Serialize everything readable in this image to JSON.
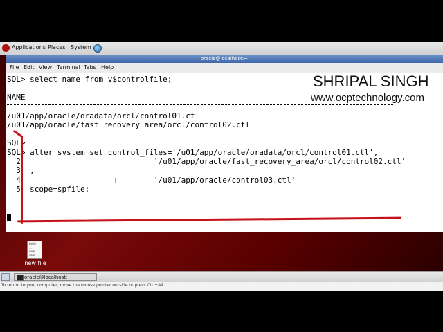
{
  "top_panel": {
    "applications": "Applications",
    "places": "Places",
    "system": "System"
  },
  "terminal": {
    "title": "oracle@localhost:~",
    "menu": [
      "File",
      "Edit",
      "View",
      "Terminal",
      "Tabs",
      "Help"
    ],
    "lines": [
      "SQL> select name from v$controlfile;",
      "",
      "NAME",
      "",
      "/u01/app/oracle/oradata/orcl/control01.ctl",
      "/u01/app/oracle/fast_recovery_area/orcl/control02.ctl",
      "",
      "SQL>",
      "SQL> alter system set control_files='/u01/app/oracle/oradata/orcl/control01.ctl',",
      "  2                             '/u01/app/oracle/fast_recovery_area/orcl/control02.ctl'",
      "  3  ,",
      "  4                             '/u01/app/oracle/control03.ctl'",
      "  5  scope=spfile;"
    ]
  },
  "watermark": {
    "name": "SHRIPAL SINGH",
    "site": "www.ocptechnology.com"
  },
  "desktop": {
    "file_icon_label": "new file",
    "file_icon_text": [
      "hello",
      "...",
      "new",
      "data"
    ]
  },
  "taskbar": {
    "window_button": "oracle@localhost:~"
  },
  "status": {
    "hint": "To return to your computer, move the mouse pointer outside or press Ctrl+Alt."
  },
  "colors": {
    "annotation_red": "#c4121b",
    "titlebar_blue": "#3f66a8",
    "desktop_red": "#7a0a0a"
  },
  "icons": {
    "distro_logo": "redhat-icon",
    "browser": "globe-icon",
    "file": "file-icon",
    "terminal": "terminal-icon",
    "show_desktop": "show-desktop-icon"
  }
}
